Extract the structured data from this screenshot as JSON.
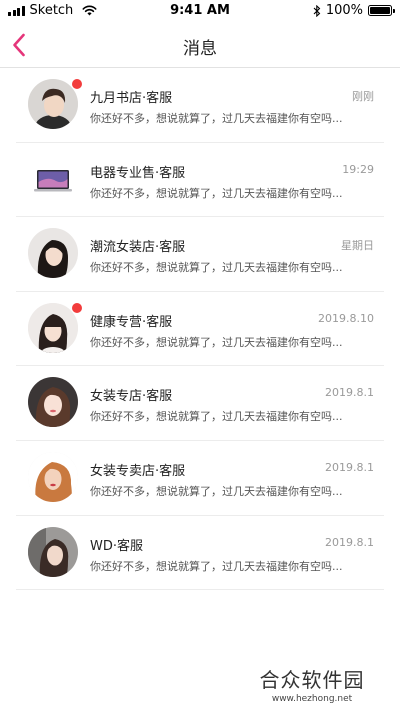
{
  "status_bar": {
    "carrier": "Sketch",
    "time": "9:41 AM",
    "battery_text": "100%",
    "battery_level": 1.0
  },
  "nav": {
    "title": "消息",
    "back_icon": "chevron-left-icon",
    "accent_color": "#e5357a"
  },
  "messages": [
    {
      "name": "九月书店·客服",
      "time": "刚刚",
      "preview": "你还好不多，想说就算了，过几天去福建你有空吗...",
      "unread": true,
      "avatar": "young-man-avatar"
    },
    {
      "name": "电器专业售·客服",
      "time": "19:29",
      "preview": "你还好不多，想说就算了，过几天去福建你有空吗...",
      "unread": false,
      "avatar": "laptop-avatar"
    },
    {
      "name": "潮流女装店·客服",
      "time": "星期日",
      "preview": "你还好不多，想说就算了，过几天去福建你有空吗...",
      "unread": false,
      "avatar": "woman-dark-hair-avatar"
    },
    {
      "name": "健康专营·客服",
      "time": "2019.8.10",
      "preview": "你还好不多，想说就算了，过几天去福建你有空吗...",
      "unread": true,
      "avatar": "woman-bangs-avatar"
    },
    {
      "name": "女装专店·客服",
      "time": "2019.8.1",
      "preview": "你还好不多，想说就算了，过几天去福建你有空吗...",
      "unread": false,
      "avatar": "woman-bright-avatar"
    },
    {
      "name": "女装专卖店·客服",
      "time": "2019.8.1",
      "preview": "你还好不多，想说就算了，过几天去福建你有空吗...",
      "unread": false,
      "avatar": "woman-blonde-avatar"
    },
    {
      "name": "WD·客服",
      "time": "2019.8.1",
      "preview": "你还好不多，想说就算了，过几天去福建你有空吗...",
      "unread": false,
      "avatar": "woman-grey-bg-avatar"
    }
  ],
  "watermark": {
    "title": "合众软件园",
    "url": "www.hezhong.net"
  },
  "colors": {
    "unread_dot": "#f23c3c",
    "time_text": "#9a9a9a",
    "divider": "#ececec"
  }
}
